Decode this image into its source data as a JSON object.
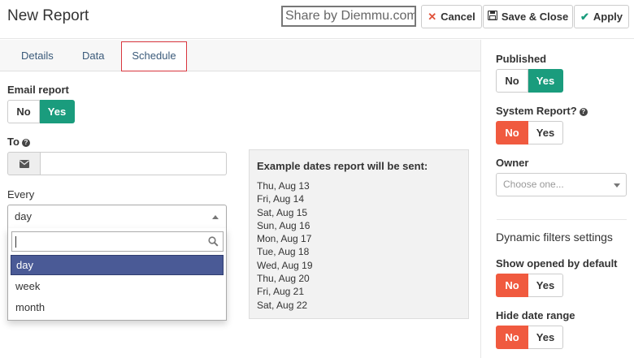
{
  "header": {
    "title": "New Report",
    "watermark": "Share by Diemmu.com",
    "cancel_label": "Cancel",
    "save_close_label": "Save & Close",
    "apply_label": "Apply"
  },
  "tabs": [
    {
      "label": "Details",
      "active": false
    },
    {
      "label": "Data",
      "active": false
    },
    {
      "label": "Schedule",
      "active": true
    }
  ],
  "schedule": {
    "email_report_label": "Email report",
    "email_report": {
      "no": "No",
      "yes": "Yes",
      "selected": "Yes"
    },
    "to_label": "To",
    "to_value": "",
    "every_label": "Every",
    "every_value": "day",
    "every_search": "",
    "every_options": [
      "day",
      "week",
      "month"
    ],
    "every_highlighted": "day"
  },
  "examples": {
    "title": "Example dates report will be sent:",
    "dates": [
      "Thu, Aug 13",
      "Fri, Aug 14",
      "Sat, Aug 15",
      "Sun, Aug 16",
      "Mon, Aug 17",
      "Tue, Aug 18",
      "Wed, Aug 19",
      "Thu, Aug 20",
      "Fri, Aug 21",
      "Sat, Aug 22"
    ]
  },
  "sidebar": {
    "published_label": "Published",
    "published": {
      "no": "No",
      "yes": "Yes",
      "selected": "Yes"
    },
    "system_report_label": "System Report?",
    "system_report": {
      "no": "No",
      "yes": "Yes",
      "selected": "No"
    },
    "owner_label": "Owner",
    "owner_placeholder": "Choose one...",
    "dynamic_filters_label": "Dynamic filters settings",
    "show_opened_label": "Show opened by default",
    "show_opened": {
      "no": "No",
      "yes": "Yes",
      "selected": "No"
    },
    "hide_date_range_label": "Hide date range",
    "hide_date_range": {
      "no": "No",
      "yes": "Yes",
      "selected": "No"
    }
  },
  "colors": {
    "accent_green": "#1a9c7d",
    "accent_red": "#f05a3f",
    "highlight_blue": "#4a5a96",
    "tab_link": "#3a5a7a"
  },
  "icons": [
    "close-icon",
    "save-icon",
    "check-icon",
    "help-icon",
    "envelope-icon",
    "caret-up-icon",
    "search-icon",
    "caret-down-icon"
  ]
}
